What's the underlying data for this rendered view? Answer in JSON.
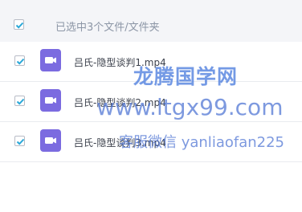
{
  "header": {
    "label": "已选中3个文件/文件夹",
    "checked": true
  },
  "files": [
    {
      "name": "吕氏-隐型谈判1.mp4",
      "checked": true,
      "icon": "video-icon"
    },
    {
      "name": "吕氏-隐型谈判2.mp4",
      "checked": true,
      "icon": "video-icon"
    },
    {
      "name": "吕氏-隐型谈判3.mp4",
      "checked": true,
      "icon": "video-icon"
    }
  ],
  "watermark": {
    "line1": "龙腾国学网",
    "line2": "www.ltgx99.com",
    "line3": "客服微信 yanliaofan225"
  },
  "colors": {
    "accent": "#2aa8d8",
    "file_icon": "#7b6be0",
    "header_bg": "#f4f5f8"
  }
}
